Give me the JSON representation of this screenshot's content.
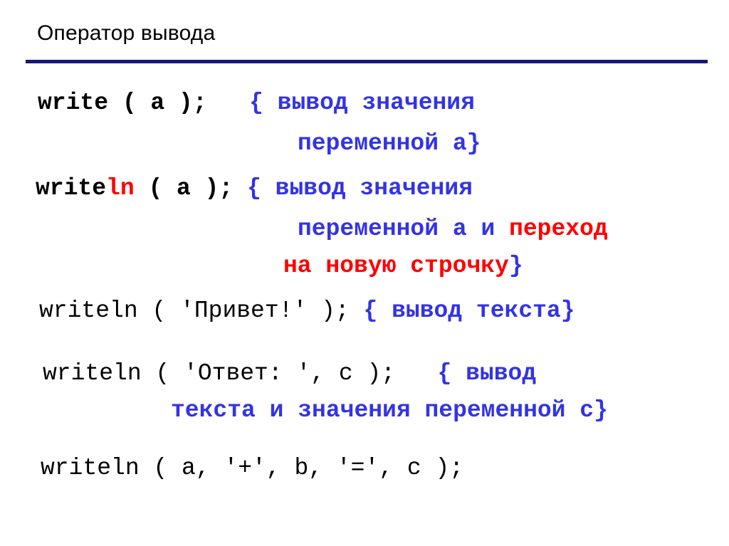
{
  "slide": {
    "title": "Оператор вывода",
    "rule_color": "#181878",
    "background": "#ffffff"
  },
  "colors": {
    "code": "#000000",
    "comment": "#3333E6",
    "highlight": "#FF0000",
    "rule": "#181878"
  },
  "code": {
    "block1": {
      "statement": "write ( a );",
      "gap": "   ",
      "comment_line1": "{ вывод значения",
      "comment_line2": "переменной a}"
    },
    "block2": {
      "keyword_head": "write",
      "keyword_tail": "ln",
      "statement_rest": " ( a ); ",
      "comment_line1": "{ вывод значения",
      "comment_line2_blue": "переменной a и ",
      "comment_line2_red": "переход",
      "comment_line3_red": "на новую строчку",
      "comment_line3_close": "}"
    },
    "block3": {
      "statement": "writeln ( 'Привет!' ); ",
      "comment": "{ вывод текста}"
    },
    "block4": {
      "statement": "writeln ( 'Ответ: ', c );",
      "gap": "   ",
      "comment_line1": "{ вывод",
      "comment_line2": "текста и значения переменной c}"
    },
    "block5": {
      "statement": "writeln ( a, '+', b, '=', c );"
    }
  }
}
